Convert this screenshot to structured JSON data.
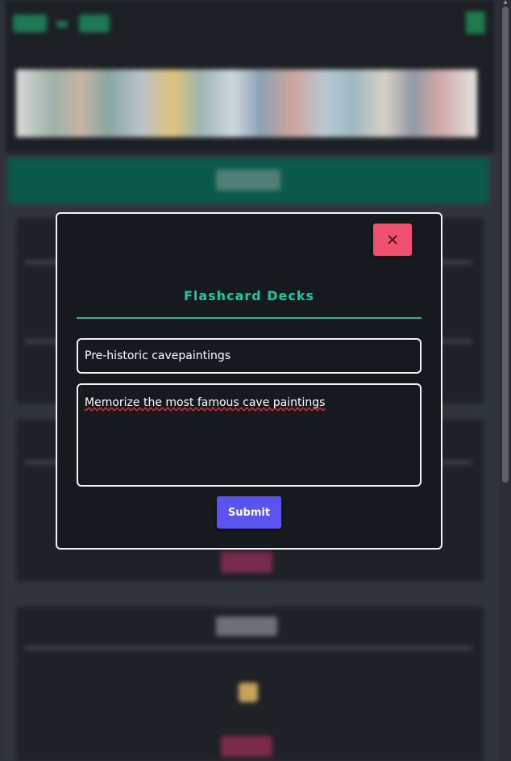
{
  "modal": {
    "title": "Flashcard Decks",
    "close_icon": "close-icon",
    "name_value": "Pre-historic cavepaintings",
    "description_value": "Memorize the most famous cave paintings",
    "submit_label": "Submit"
  },
  "colors": {
    "accent": "#1bc8a4",
    "close_button": "#f0506e",
    "submit_button": "#5b53f0",
    "background_category": "#0b5a4c"
  }
}
